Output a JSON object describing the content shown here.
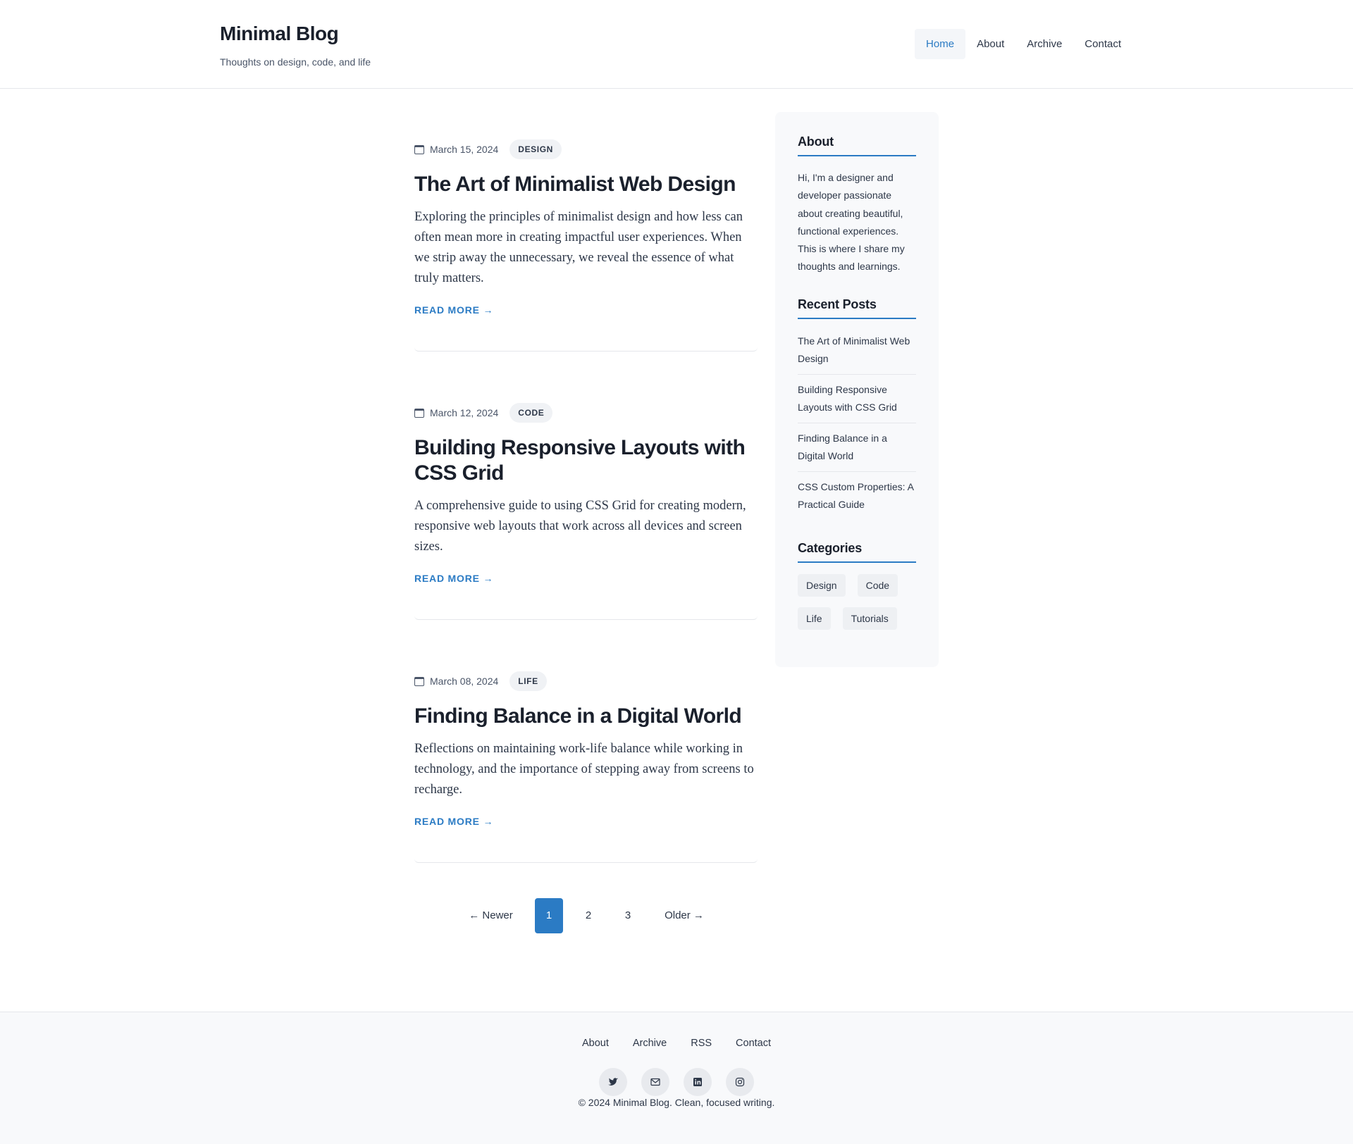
{
  "header": {
    "title": "Minimal Blog",
    "tagline": "Thoughts on design, code, and life",
    "nav": [
      {
        "label": "Home",
        "active": true
      },
      {
        "label": "About",
        "active": false
      },
      {
        "label": "Archive",
        "active": false
      },
      {
        "label": "Contact",
        "active": false
      }
    ]
  },
  "posts": [
    {
      "date": "March 15, 2024",
      "tag": "DESIGN",
      "title": "The Art of Minimalist Web Design",
      "excerpt": "Exploring the principles of minimalist design and how less can often mean more in creating impactful user experiences. When we strip away the unnecessary, we reveal the essence of what truly matters.",
      "read_more": "READ MORE →"
    },
    {
      "date": "March 12, 2024",
      "tag": "CODE",
      "title": "Building Responsive Layouts with CSS Grid",
      "excerpt": "A comprehensive guide to using CSS Grid for creating modern, responsive web layouts that work across all devices and screen sizes.",
      "read_more": "READ MORE →"
    },
    {
      "date": "March 08, 2024",
      "tag": "LIFE",
      "title": "Finding Balance in a Digital World",
      "excerpt": "Reflections on maintaining work-life balance while working in technology, and the importance of stepping away from screens to recharge.",
      "read_more": "READ MORE →"
    }
  ],
  "pagination": {
    "newer": "← Newer",
    "pages": [
      "1",
      "2",
      "3"
    ],
    "current": "1",
    "older": "Older →"
  },
  "sidebar": {
    "about_title": "About",
    "about_text": "Hi, I'm a designer and developer passionate about creating beautiful, functional experiences. This is where I share my thoughts and learnings.",
    "recent_title": "Recent Posts",
    "recent": [
      "The Art of Minimalist Web Design",
      "Building Responsive Layouts with CSS Grid",
      "Finding Balance in a Digital World",
      "CSS Custom Properties: A Practical Guide"
    ],
    "categories_title": "Categories",
    "categories": [
      "Design",
      "Code",
      "Life",
      "Tutorials"
    ]
  },
  "footer": {
    "links": [
      "About",
      "Archive",
      "RSS",
      "Contact"
    ],
    "social": [
      "twitter-icon",
      "mail-icon",
      "linkedin-icon",
      "instagram-icon"
    ],
    "copyright": "© 2024 Minimal Blog. Clean, focused writing."
  },
  "colors": {
    "accent": "#2b7bc4",
    "text": "#1a202c",
    "muted": "#4a5568",
    "sidebar_bg": "#f8f9fb"
  }
}
